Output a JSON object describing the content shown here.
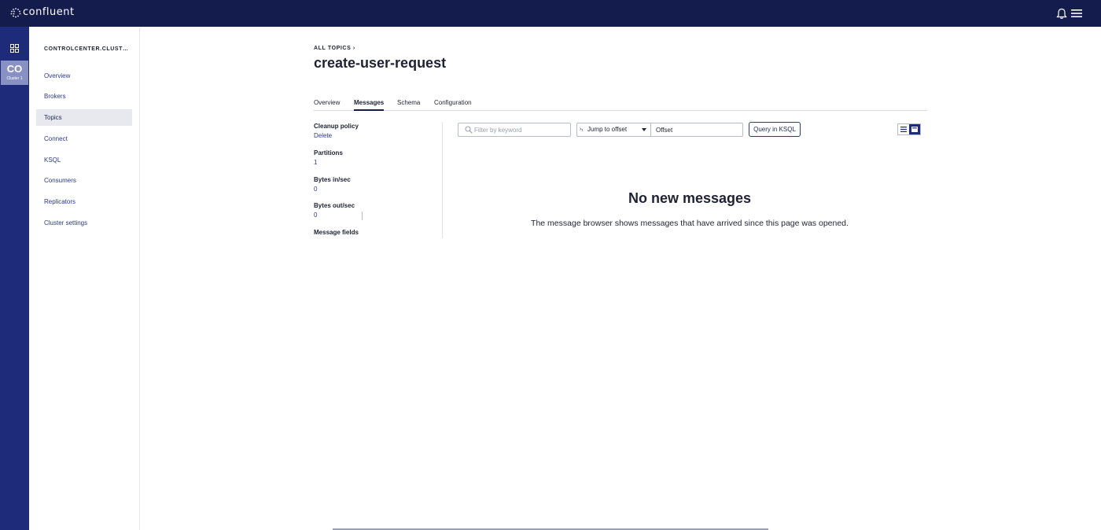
{
  "brand": {
    "name": "confluent"
  },
  "rail": {
    "cluster_abbr": "CO",
    "cluster_name": "Cluster 1"
  },
  "sidebar": {
    "cluster_title": "CONTROLCENTER.CLUST…",
    "items": [
      {
        "label": "Overview"
      },
      {
        "label": "Brokers"
      },
      {
        "label": "Topics",
        "active": true
      },
      {
        "label": "Connect"
      },
      {
        "label": "KSQL"
      },
      {
        "label": "Consumers"
      },
      {
        "label": "Replicators"
      },
      {
        "label": "Cluster settings"
      }
    ]
  },
  "header": {
    "breadcrumb": "ALL TOPICS",
    "title": "create-user-request"
  },
  "tabs": [
    {
      "label": "Overview"
    },
    {
      "label": "Messages",
      "active": true
    },
    {
      "label": "Schema"
    },
    {
      "label": "Configuration"
    }
  ],
  "info": {
    "cleanup_policy_label": "Cleanup policy",
    "cleanup_policy_value": "Delete",
    "partitions_label": "Partitions",
    "partitions_value": "1",
    "bytes_in_label": "Bytes in/sec",
    "bytes_in_value": "0",
    "bytes_out_label": "Bytes out/sec",
    "bytes_out_value": "0",
    "message_fields_label": "Message fields"
  },
  "toolbar": {
    "search_placeholder": "Filter by keyword",
    "jump_label": "Jump to offset",
    "offset_placeholder": "Offset",
    "query_button": "Query in KSQL"
  },
  "empty_state": {
    "title": "No new messages",
    "description": "The message browser shows messages that have arrived since this page was opened."
  },
  "colors": {
    "topbar": "#141b4d",
    "rail": "#1e2a7a",
    "accent": "#2b3a8c"
  }
}
